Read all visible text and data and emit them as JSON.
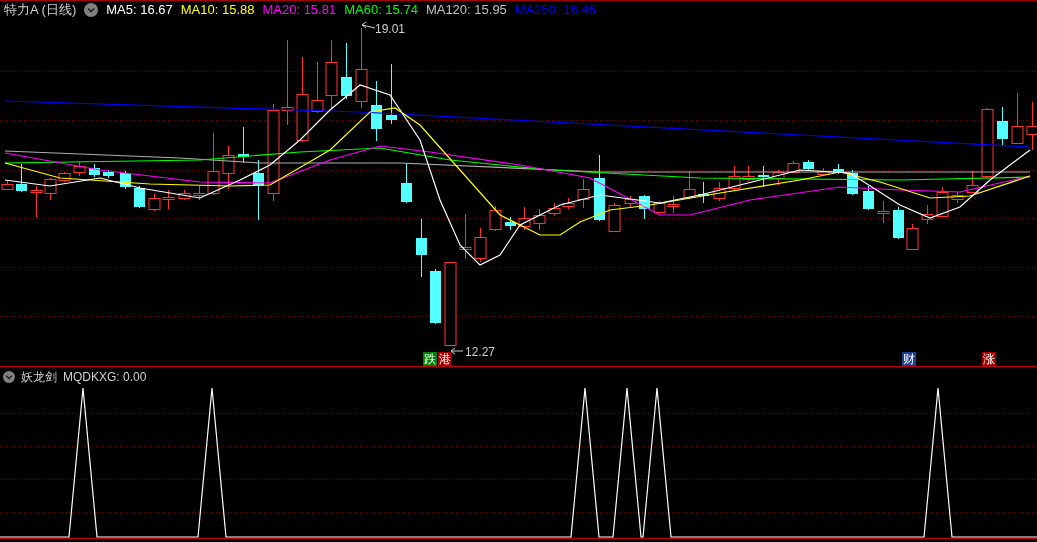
{
  "header": {
    "title": "特力A (日线)",
    "averages": [
      {
        "label": "MA5: 16.67",
        "color": "#ffffff"
      },
      {
        "label": "MA10: 15.88",
        "color": "#ffff00"
      },
      {
        "label": "MA20: 15.81",
        "color": "#ff00ff"
      },
      {
        "label": "MA60: 15.74",
        "color": "#00ff00"
      },
      {
        "label": "MA120: 15.95",
        "color": "#c0c0c0"
      },
      {
        "label": "MA250: 16.46",
        "color": "#0000ff"
      }
    ]
  },
  "price_labels": {
    "high": "19.01",
    "low": "12.27"
  },
  "signal_markers": [
    {
      "text": "跌",
      "color": "#008000"
    },
    {
      "text": "港",
      "color": "#a00000"
    },
    {
      "text": "财",
      "color": "#1a3d8f"
    },
    {
      "text": "涨",
      "color": "#a00000"
    }
  ],
  "indicator_panel": {
    "title": "妖龙剑",
    "reading": "MQDKXG: 0.00"
  }
}
